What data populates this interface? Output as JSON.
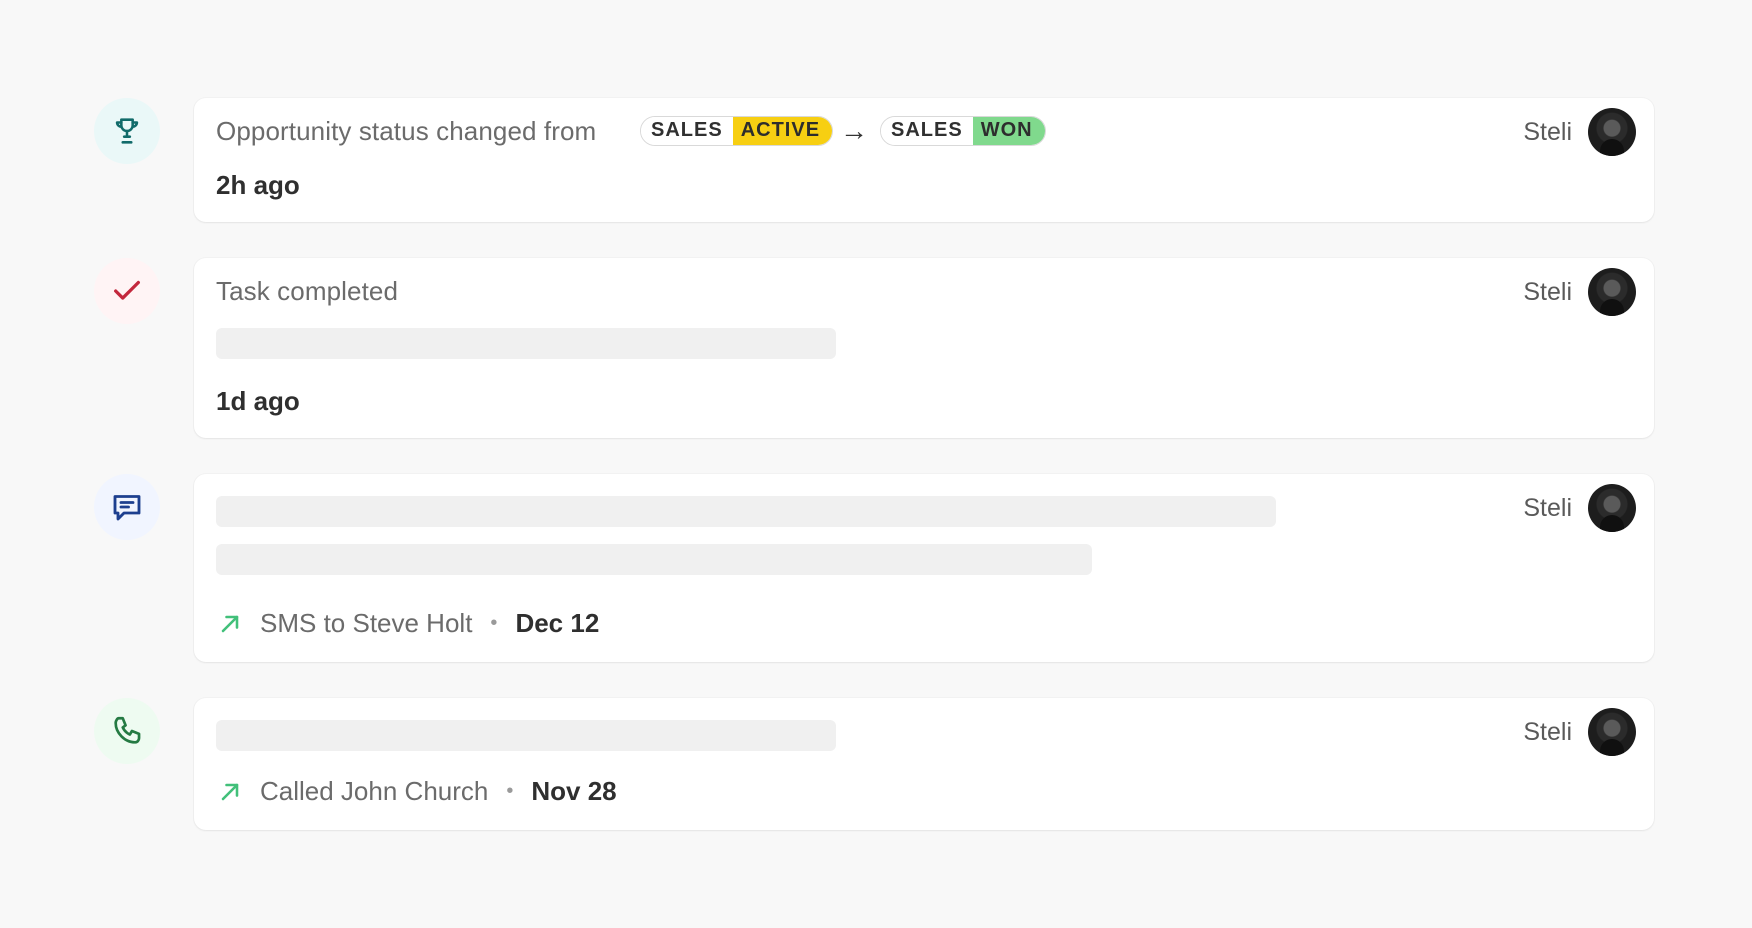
{
  "colors": {
    "background": "#f8f8f8",
    "card": "#ffffff",
    "trophy_icon": "#116b6a",
    "trophy_bg": "#eaf8f8",
    "check_icon": "#c3283d",
    "check_bg": "#fff4f5",
    "message_icon": "#1d3f8f",
    "message_bg": "#f1f5ff",
    "phone_icon": "#257a43",
    "phone_bg": "#eefbf1",
    "active_badge": "#f7cf12",
    "won_badge": "#80d98d",
    "outbound_arrow": "#42c07a",
    "skeleton": "#f0f0f0"
  },
  "events": [
    {
      "icon": "trophy-icon",
      "title": "Opportunity status changed from",
      "from_status": {
        "type": "SALES",
        "status": "ACTIVE"
      },
      "arrow": "→",
      "to_status": {
        "type": "SALES",
        "status": "WON"
      },
      "time_ago": "2h ago",
      "owner": {
        "name": "Steli",
        "avatar": "user-avatar"
      }
    },
    {
      "icon": "check-icon",
      "title": "Task completed",
      "time_ago": "1d ago",
      "owner": {
        "name": "Steli",
        "avatar": "user-avatar"
      }
    },
    {
      "icon": "message-icon",
      "activity": {
        "direction_icon": "outbound-arrow-icon",
        "description": "SMS to Steve Holt",
        "separator": "•",
        "date": "Dec 12"
      },
      "owner": {
        "name": "Steli",
        "avatar": "user-avatar"
      }
    },
    {
      "icon": "phone-icon",
      "activity": {
        "direction_icon": "outbound-arrow-icon",
        "description": "Called John Church",
        "separator": "•",
        "date": "Nov 28"
      },
      "owner": {
        "name": "Steli",
        "avatar": "user-avatar"
      }
    }
  ]
}
